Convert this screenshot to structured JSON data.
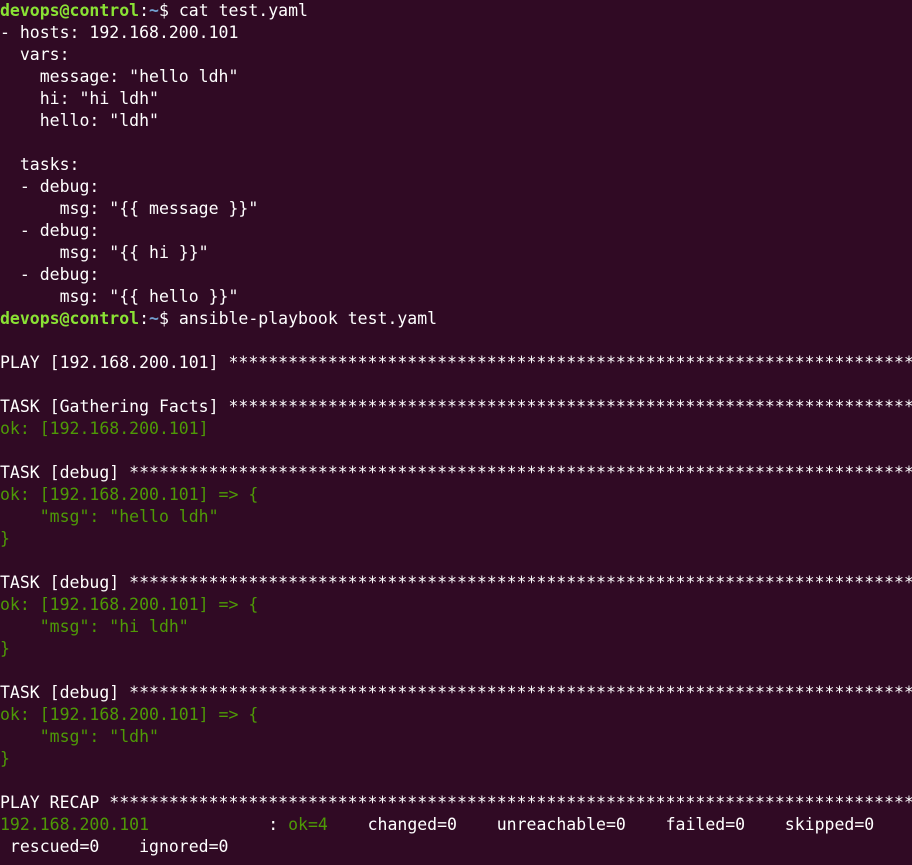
{
  "colors": {
    "background": "#300a24",
    "text": "#ffffff",
    "ok_green": "#4e9a06",
    "prompt_user": "#8ae234",
    "prompt_path": "#729fcf"
  },
  "prompt": {
    "user_host": "devops@control",
    "sep": ":",
    "path": "~",
    "symbol": "$ "
  },
  "lines": [
    {
      "t": "cmd",
      "text": "cat test.yaml"
    },
    {
      "t": "w",
      "text": "- hosts: 192.168.200.101"
    },
    {
      "t": "w",
      "text": "  vars:"
    },
    {
      "t": "w",
      "text": "    message: \"hello ldh\""
    },
    {
      "t": "w",
      "text": "    hi: \"hi ldh\""
    },
    {
      "t": "w",
      "text": "    hello: \"ldh\""
    },
    {
      "t": "w",
      "text": ""
    },
    {
      "t": "w",
      "text": "  tasks:"
    },
    {
      "t": "w",
      "text": "  - debug:"
    },
    {
      "t": "w",
      "text": "      msg: \"{{ message }}\""
    },
    {
      "t": "w",
      "text": "  - debug:"
    },
    {
      "t": "w",
      "text": "      msg: \"{{ hi }}\""
    },
    {
      "t": "w",
      "text": "  - debug:"
    },
    {
      "t": "w",
      "text": "      msg: \"{{ hello }}\""
    },
    {
      "t": "cmd",
      "text": "ansible-playbook test.yaml"
    },
    {
      "t": "w",
      "text": ""
    },
    {
      "t": "w",
      "text": "PLAY [192.168.200.101] **************************************************************************************"
    },
    {
      "t": "w",
      "text": ""
    },
    {
      "t": "w",
      "text": "TASK [Gathering Facts] **************************************************************************************"
    },
    {
      "t": "g",
      "text": "ok: [192.168.200.101]"
    },
    {
      "t": "w",
      "text": ""
    },
    {
      "t": "w",
      "text": "TASK [debug] ************************************************************************************************"
    },
    {
      "t": "g",
      "text": "ok: [192.168.200.101] => {"
    },
    {
      "t": "g",
      "text": "    \"msg\": \"hello ldh\""
    },
    {
      "t": "g",
      "text": "}"
    },
    {
      "t": "w",
      "text": ""
    },
    {
      "t": "w",
      "text": "TASK [debug] ************************************************************************************************"
    },
    {
      "t": "g",
      "text": "ok: [192.168.200.101] => {"
    },
    {
      "t": "g",
      "text": "    \"msg\": \"hi ldh\""
    },
    {
      "t": "g",
      "text": "}"
    },
    {
      "t": "w",
      "text": ""
    },
    {
      "t": "w",
      "text": "TASK [debug] ************************************************************************************************"
    },
    {
      "t": "g",
      "text": "ok: [192.168.200.101] => {"
    },
    {
      "t": "g",
      "text": "    \"msg\": \"ldh\""
    },
    {
      "t": "g",
      "text": "}"
    },
    {
      "t": "w",
      "text": ""
    },
    {
      "t": "w",
      "text": "PLAY RECAP **************************************************************************************************"
    },
    {
      "t": "recap"
    },
    {
      "t": "w",
      "text": " rescued=0    ignored=0"
    }
  ],
  "recap": {
    "host": "192.168.200.101",
    "pad": "            : ",
    "ok": "ok=4",
    "rest": "    changed=0    unreachable=0    failed=0    skipped=0"
  }
}
